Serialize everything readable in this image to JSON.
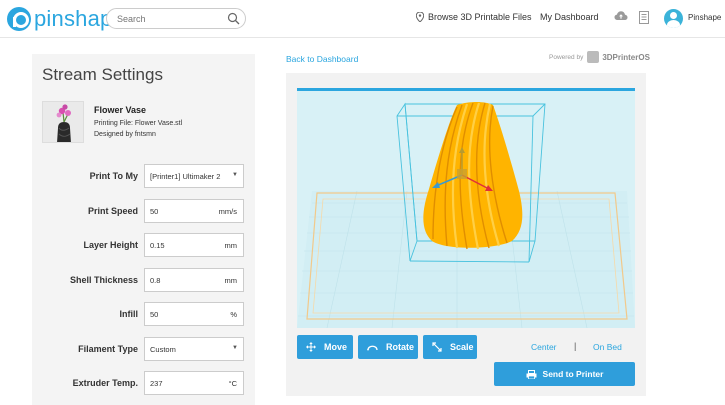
{
  "header": {
    "logo_text": "pinshape",
    "search_placeholder": "Search",
    "browse_label": "Browse 3D Printable Files",
    "dashboard_label": "My Dashboard",
    "username": "Pinshape"
  },
  "left": {
    "title": "Stream Settings",
    "file": {
      "name": "Flower Vase",
      "printing_file": "Printing File: Flower Vase.stl",
      "designer": "Designed by fntsmn"
    },
    "fields": [
      {
        "label": "Print To My",
        "value": "[Printer1] Ultimaker 2",
        "unit": "",
        "type": "select"
      },
      {
        "label": "Print Speed",
        "value": "50",
        "unit": "mm/s",
        "type": "input"
      },
      {
        "label": "Layer Height",
        "value": "0.15",
        "unit": "mm",
        "type": "input"
      },
      {
        "label": "Shell Thickness",
        "value": "0.8",
        "unit": "mm",
        "type": "input"
      },
      {
        "label": "Infill",
        "value": "50",
        "unit": "%",
        "type": "input"
      },
      {
        "label": "Filament Type",
        "value": "Custom",
        "unit": "",
        "type": "select"
      },
      {
        "label": "Extruder Temp.",
        "value": "237",
        "unit": "°C",
        "type": "input"
      }
    ]
  },
  "right": {
    "back_link": "Back to Dashboard",
    "powered_label": "Powered by",
    "powered_brand": "3DPrinterOS",
    "buttons": {
      "move": "Move",
      "rotate": "Rotate",
      "scale": "Scale",
      "center": "Center",
      "separator": "|",
      "on_bed": "On Bed",
      "send": "Send to Printer"
    }
  },
  "colors": {
    "brand": "#2ba6df",
    "button": "#2f9edb",
    "model": "#ffb400",
    "viewport_bg": "#d8f1f6"
  }
}
